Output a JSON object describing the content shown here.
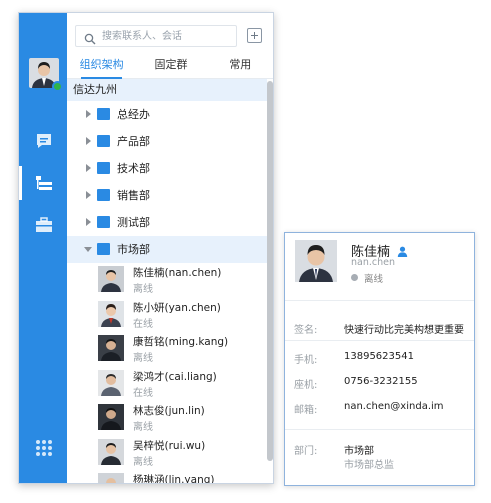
{
  "search": {
    "placeholder": "搜索联系人、会话"
  },
  "tabs": [
    {
      "label": "组织架构",
      "active": true
    },
    {
      "label": "固定群",
      "active": false
    },
    {
      "label": "常用",
      "active": false
    }
  ],
  "org": {
    "name": "信达九州",
    "departments": [
      {
        "name": "总经办",
        "expanded": false
      },
      {
        "name": "产品部",
        "expanded": false
      },
      {
        "name": "技术部",
        "expanded": false
      },
      {
        "name": "销售部",
        "expanded": false
      },
      {
        "name": "测试部",
        "expanded": false
      },
      {
        "name": "市场部",
        "expanded": true
      }
    ]
  },
  "members": [
    {
      "name": "陈佳楠(nan.chen)",
      "status": "离线"
    },
    {
      "name": "陈小妍(yan.chen)",
      "status": "在线"
    },
    {
      "name": "康哲铭(ming.kang)",
      "status": "离线"
    },
    {
      "name": "梁鸿才(cai.liang)",
      "status": "在线"
    },
    {
      "name": "林志俊(jun.lin)",
      "status": "离线"
    },
    {
      "name": "吴梓悦(rui.wu)",
      "status": "离线"
    },
    {
      "name": "杨琳涵(lin.yang)",
      "status": ""
    }
  ],
  "card": {
    "name": "陈佳楠",
    "account": "nan.chen",
    "status": "离线",
    "signature_label": "签名:",
    "signature": "快速行动比完美构想更重要",
    "mobile_label": "手机:",
    "mobile": "13895623541",
    "phone_label": "座机:",
    "phone": "0756-3232155",
    "email_label": "邮箱:",
    "email": "nan.chen@xinda.im",
    "dept_label": "部门:",
    "dept": "市场部",
    "title": "市场部总监"
  },
  "colors": {
    "accent": "#2a8ae3",
    "online": "#2fb34a",
    "offline_dot": "#a7adb4",
    "selected_row": "#e7f1fc"
  },
  "icons": [
    "search-icon",
    "add-icon",
    "chat-icon",
    "contacts-icon",
    "workbench-icon",
    "apps-grid-icon",
    "folder-icon",
    "person-icon"
  ]
}
